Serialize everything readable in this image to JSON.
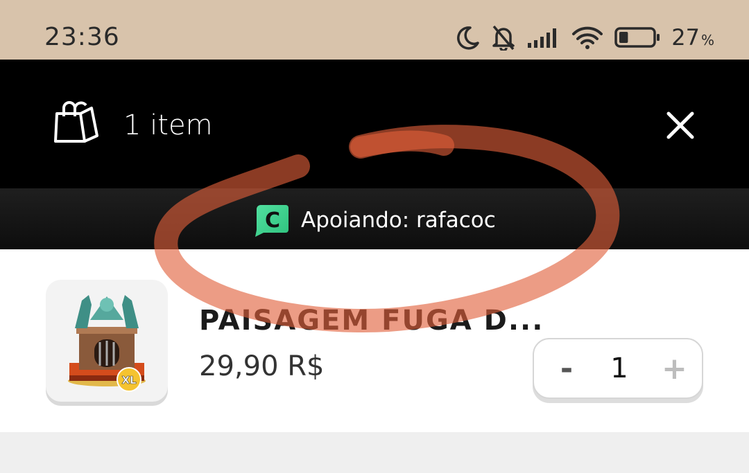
{
  "status_bar": {
    "time": "23:36",
    "battery_percent": "27",
    "battery_unit": "%",
    "battery_level": 0.27,
    "icons": [
      "moon-icon",
      "bell-off-icon",
      "signal-icon",
      "wifi-icon",
      "battery-icon"
    ]
  },
  "header": {
    "item_count_label": "1 item",
    "icons": [
      "shopping-bag-icon",
      "close-icon"
    ]
  },
  "creator": {
    "label": "Apoiando: rafacoc",
    "logo_letter": "C",
    "logo_color": "#3fd48f"
  },
  "cart": {
    "items": [
      {
        "name": "PAISAGEM FUGA D...",
        "price": "29,90 R$",
        "quantity": "1",
        "minus_label": "-",
        "plus_label": "+",
        "badge": "XL"
      }
    ]
  },
  "colors": {
    "status_bar_bg": "#d8c3ab",
    "header_bg": "#000000",
    "annotation": "#e0603a"
  }
}
